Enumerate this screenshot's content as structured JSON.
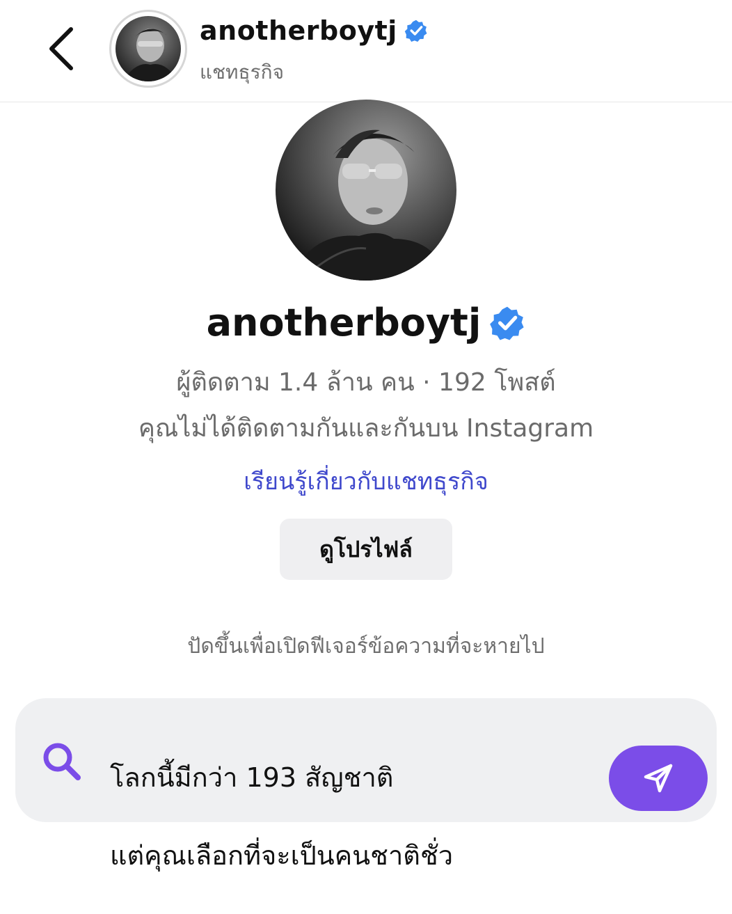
{
  "header": {
    "title": "anotherboytj",
    "subtitle": "แชทธุรกิจ",
    "back_icon": "chevron-left-icon",
    "verified_icon": "verified-badge-icon"
  },
  "profile": {
    "name": "anotherboytj",
    "stats": "ผู้ติดตาม 1.4 ล้าน คน · 192 โพสต์",
    "relationship": "คุณไม่ได้ติดตามกันและกันบน Instagram",
    "learn_link": "เรียนรู้เกี่ยวกับแชทธุรกิจ",
    "view_profile_label": "ดูโปรไฟล์"
  },
  "swipe_hint": "ปัดขึ้นเพื่อเปิดฟีเจอร์ข้อความที่จะหายไป",
  "composer": {
    "message_line1": "โลกนี้มีกว่า 193 สัญชาติ",
    "message_line2": "แต่คุณเลือกที่จะเป็นคนชาติชั่ว",
    "search_icon": "search-icon",
    "send_icon": "send-icon"
  },
  "colors": {
    "verified": "#3a8bf0",
    "link": "#3f48cc",
    "accent": "#7b4de8",
    "muted_text": "#6b6b6b"
  }
}
